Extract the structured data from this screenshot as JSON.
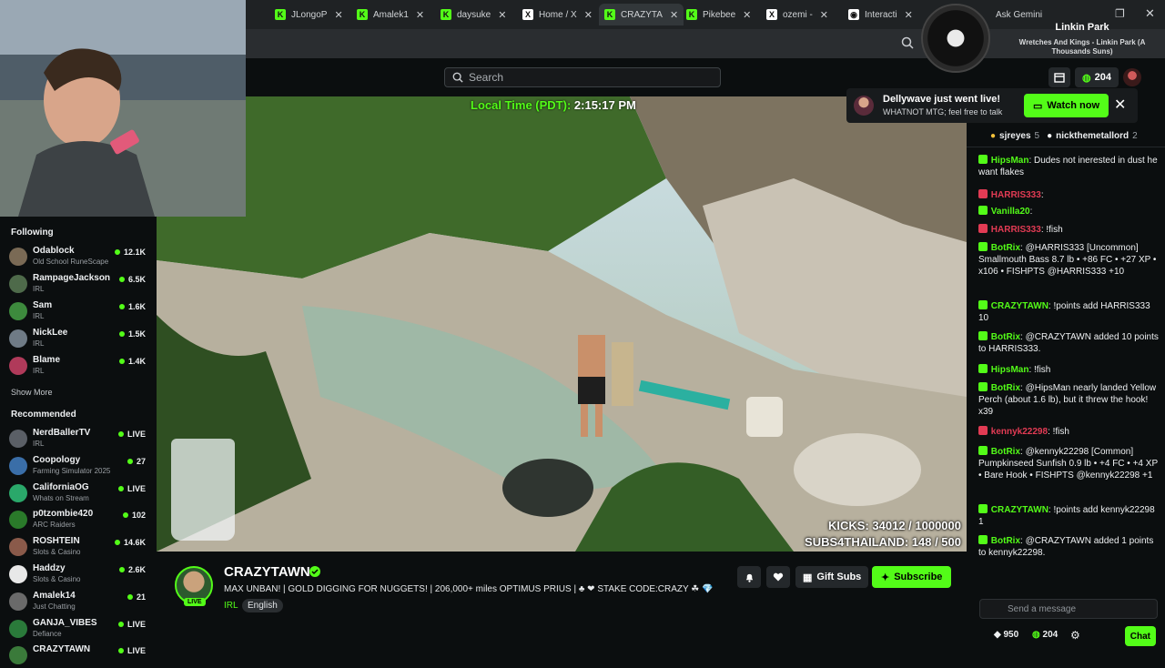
{
  "browser": {
    "tabs": [
      {
        "label": "JLongoP",
        "fav_color": "#53fc18",
        "fav_letter": "K"
      },
      {
        "label": "Amalek1",
        "fav_color": "#53fc18",
        "fav_letter": "K"
      },
      {
        "label": "daysuke",
        "fav_color": "#53fc18",
        "fav_letter": "K"
      },
      {
        "label": "Home / X",
        "fav_color": "#ffffff",
        "fav_letter": "X"
      },
      {
        "label": "CRAZYTA",
        "fav_color": "#53fc18",
        "fav_letter": "K"
      },
      {
        "label": "Pikebee",
        "fav_color": "#53fc18",
        "fav_letter": "K"
      },
      {
        "label": "ozemi - ",
        "fav_color": "#ffffff",
        "fav_letter": "X"
      },
      {
        "label": "Interacti",
        "fav_color": "#ffffff",
        "fav_letter": "◉"
      }
    ],
    "ask_label": "Ask Gemini"
  },
  "header": {
    "search_placeholder": "Search",
    "points": "204"
  },
  "now_playing": {
    "title": "Linkin Park",
    "subtitle": "Wretches And Kings - Linkin Park (A Thousands Suns)"
  },
  "toast": {
    "title": "Dellywave just went live!",
    "subtitle": "WHATNOT MTG; feel free to talk",
    "watch_label": "Watch now"
  },
  "sidebar": {
    "following_title": "Following",
    "following": [
      {
        "name": "Odablock",
        "category": "Old School RuneScape",
        "count": "12.1K",
        "color": "#7a6a55"
      },
      {
        "name": "RampageJackson",
        "category": "IRL",
        "count": "6.5K",
        "color": "#4e6a4a"
      },
      {
        "name": "Sam",
        "category": "IRL",
        "count": "1.6K",
        "color": "#3d8a3d"
      },
      {
        "name": "NickLee",
        "category": "IRL",
        "count": "1.5K",
        "color": "#6f7b86"
      },
      {
        "name": "Blame",
        "category": "IRL",
        "count": "1.4K",
        "color": "#b03a5a"
      }
    ],
    "show_more": "Show More",
    "recommended_title": "Recommended",
    "recommended": [
      {
        "name": "NerdBallerTV",
        "category": "IRL",
        "count": "LIVE",
        "color": "#5a5f66"
      },
      {
        "name": "Coopology",
        "category": "Farming Simulator 2025",
        "count": "27",
        "color": "#3a6ea8"
      },
      {
        "name": "CaliforniaOG",
        "category": "Whats on Stream",
        "count": "LIVE",
        "color": "#2aa86a"
      },
      {
        "name": "p0tzombie420",
        "category": "ARC Raiders",
        "count": "102",
        "color": "#2a7a2a"
      },
      {
        "name": "ROSHTEIN",
        "category": "Slots & Casino",
        "count": "14.6K",
        "color": "#8a5a4a"
      },
      {
        "name": "Haddzy",
        "category": "Slots & Casino",
        "count": "2.6K",
        "color": "#e8e8e8"
      },
      {
        "name": "Amalek14",
        "category": "Just Chatting",
        "count": "21",
        "color": "#6a6a6a"
      },
      {
        "name": "GANJA_VIBES",
        "category": "Defiance",
        "count": "LIVE",
        "color": "#2a7a3a"
      },
      {
        "name": "CRAZYTAWN",
        "category": "",
        "count": "LIVE",
        "color": "#3a7a3a"
      }
    ]
  },
  "video": {
    "local_time_label": "Local Time (PDT):",
    "local_time_value": "2:15:17 PM",
    "kicks_line": "KICKS: 34012 / 1000000",
    "subs_line": "SUBS4THAILAND: 148 / 500"
  },
  "channel": {
    "name": "CRAZYTAWN",
    "live_label": "LIVE",
    "title": "MAX UNBAN! | GOLD DIGGING FOR NUGGETS! | 206,000+ miles OPTIMUS PRIUS | ♣ ❤ STAKE CODE:CRAZY ☘ 💎",
    "category": "IRL",
    "language": "English",
    "gift_label": "Gift Subs",
    "subscribe_label": "Subscribe"
  },
  "chat": {
    "pinned": [
      {
        "name": "sjreyes",
        "n": "5"
      },
      {
        "name": "nickthemetallord",
        "n": "2"
      }
    ],
    "messages": [
      {
        "user": "HipsMan",
        "color": "#53fc18",
        "text": "Dudes not inerested in dust he want flakes"
      },
      {
        "user": "HARRIS333",
        "color": "#e23b54",
        "text": ""
      },
      {
        "user": "Vanilla20",
        "color": "#53fc18",
        "text": ""
      },
      {
        "user": "HARRIS333",
        "color": "#e23b54",
        "text": "!fish"
      },
      {
        "user": "BotRix",
        "color": "#53fc18",
        "text": "@HARRIS333 [Uncommon] Smallmouth Bass 8.7 lb • +86 FC • +27 XP • x106 • FISHPTS @HARRIS333 +10"
      },
      {
        "user": "CRAZYTAWN",
        "color": "#53fc18",
        "text": "!points add HARRIS333 10"
      },
      {
        "user": "BotRix",
        "color": "#53fc18",
        "text": "@CRAZYTAWN added 10 points to HARRIS333."
      },
      {
        "user": "HipsMan",
        "color": "#53fc18",
        "text": "!fish"
      },
      {
        "user": "BotRix",
        "color": "#53fc18",
        "text": "@HipsMan nearly landed Yellow Perch (about 1.6 lb), but it threw the hook! x39"
      },
      {
        "user": "kennyk22298",
        "color": "#e23b54",
        "text": "!fish"
      },
      {
        "user": "BotRix",
        "color": "#53fc18",
        "text": "@kennyk22298 [Common] Pumpkinseed Sunfish 0.9 lb • +4 FC • +4 XP • Bare Hook • FISHPTS @kennyk22298 +1"
      },
      {
        "user": "CRAZYTAWN",
        "color": "#53fc18",
        "text": "!points add kennyk22298 1"
      },
      {
        "user": "BotRix",
        "color": "#53fc18",
        "text": "@CRAZYTAWN added 1 points to kennyk22298."
      }
    ],
    "input_placeholder": "Send a message",
    "kicks": "950",
    "points": "204",
    "send_label": "Chat"
  }
}
